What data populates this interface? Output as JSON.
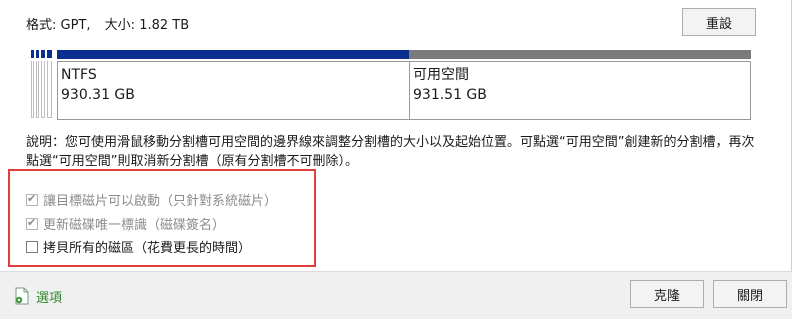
{
  "disk": {
    "format_label": "格式:",
    "format_value": "GPT,",
    "size_label": "大小:",
    "size_value": "1.82 TB"
  },
  "buttons": {
    "reset": "重設",
    "clone": "克隆",
    "close": "關閉"
  },
  "partitions": [
    {
      "name": "NTFS",
      "size": "930.31 GB",
      "color": "#0a2f8e"
    },
    {
      "name": "可用空間",
      "size": "931.51 GB",
      "color": "#7a7a7a"
    }
  ],
  "description": "說明：您可使用滑鼠移動分割槽可用空間的邊界線來調整分割槽的大小以及起始位置。可點選“可用空間”創建新的分割槽，再次點選“可用空間”則取消新分割槽（原有分割槽不可刪除）。",
  "options": [
    {
      "label": "讓目標磁片可以啟動（只針對系統磁片）",
      "checked": true,
      "disabled": true
    },
    {
      "label": "更新磁碟唯一標識（磁碟簽名）",
      "checked": true,
      "disabled": true
    },
    {
      "label": "拷貝所有的磁區（花費更長的時間）",
      "checked": false,
      "disabled": false
    }
  ],
  "footer": {
    "options_link": "選項",
    "options_icon": "page-gear-icon"
  },
  "colors": {
    "highlight_border": "#e0403a",
    "link_green": "#2f8a2f"
  }
}
